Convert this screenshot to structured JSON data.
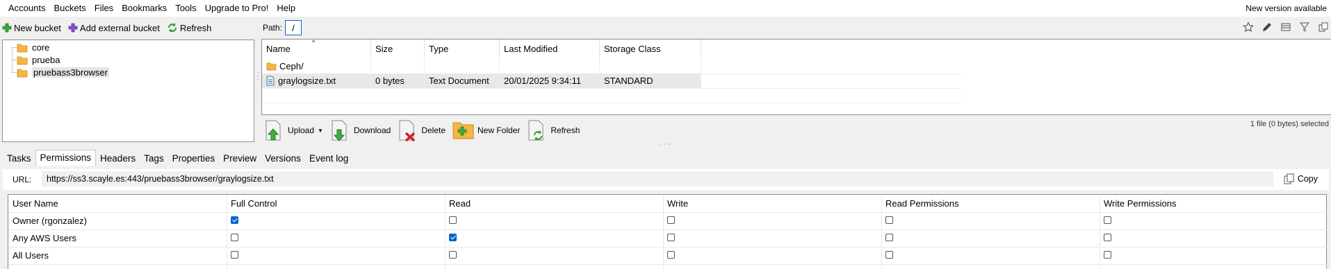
{
  "menu": {
    "items": [
      "Accounts",
      "Buckets",
      "Files",
      "Bookmarks",
      "Tools",
      "Upgrade to Pro!",
      "Help"
    ],
    "notice": "New version available"
  },
  "left_toolbar": {
    "new_bucket": "New bucket",
    "add_external": "Add external bucket",
    "refresh": "Refresh"
  },
  "path": {
    "label": "Path:",
    "value": "/"
  },
  "tree": {
    "items": [
      "core",
      "prueba",
      "pruebass3browser"
    ],
    "selected": "pruebass3browser"
  },
  "filelist": {
    "columns": [
      "Name",
      "Size",
      "Type",
      "Last Modified",
      "Storage Class"
    ],
    "rows": [
      {
        "name": "Ceph/",
        "size": "",
        "type": "",
        "modified": "",
        "storage": "",
        "icon": "folder-icon"
      },
      {
        "name": "graylogsize.txt",
        "size": "0 bytes",
        "type": "Text Document",
        "modified": "20/01/2025 9:34:11",
        "storage": "STANDARD",
        "icon": "text-file-icon"
      }
    ]
  },
  "actions": {
    "upload": "Upload",
    "download": "Download",
    "delete": "Delete",
    "new_folder": "New Folder",
    "refresh": "Refresh",
    "file_count": "1 file (0 bytes) selected"
  },
  "tabs": [
    "Tasks",
    "Permissions",
    "Headers",
    "Tags",
    "Properties",
    "Preview",
    "Versions",
    "Event log"
  ],
  "active_tab": "Permissions",
  "url": {
    "label": "URL:",
    "value": "https://ss3.scayle.es:443/pruebass3browser/graylogsize.txt",
    "copy": "Copy"
  },
  "permissions": {
    "columns": [
      "User Name",
      "Full Control",
      "Read",
      "Write",
      "Read Permissions",
      "Write Permissions"
    ],
    "rows": [
      {
        "user": "Owner (rgonzalez)",
        "checks": [
          true,
          false,
          false,
          false,
          false
        ]
      },
      {
        "user": "Any AWS Users",
        "checks": [
          false,
          true,
          false,
          false,
          false
        ]
      },
      {
        "user": "All Users",
        "checks": [
          false,
          false,
          false,
          false,
          false
        ]
      }
    ]
  },
  "colors": {
    "accent": "#0a64c8",
    "folder": "#f5b642"
  }
}
